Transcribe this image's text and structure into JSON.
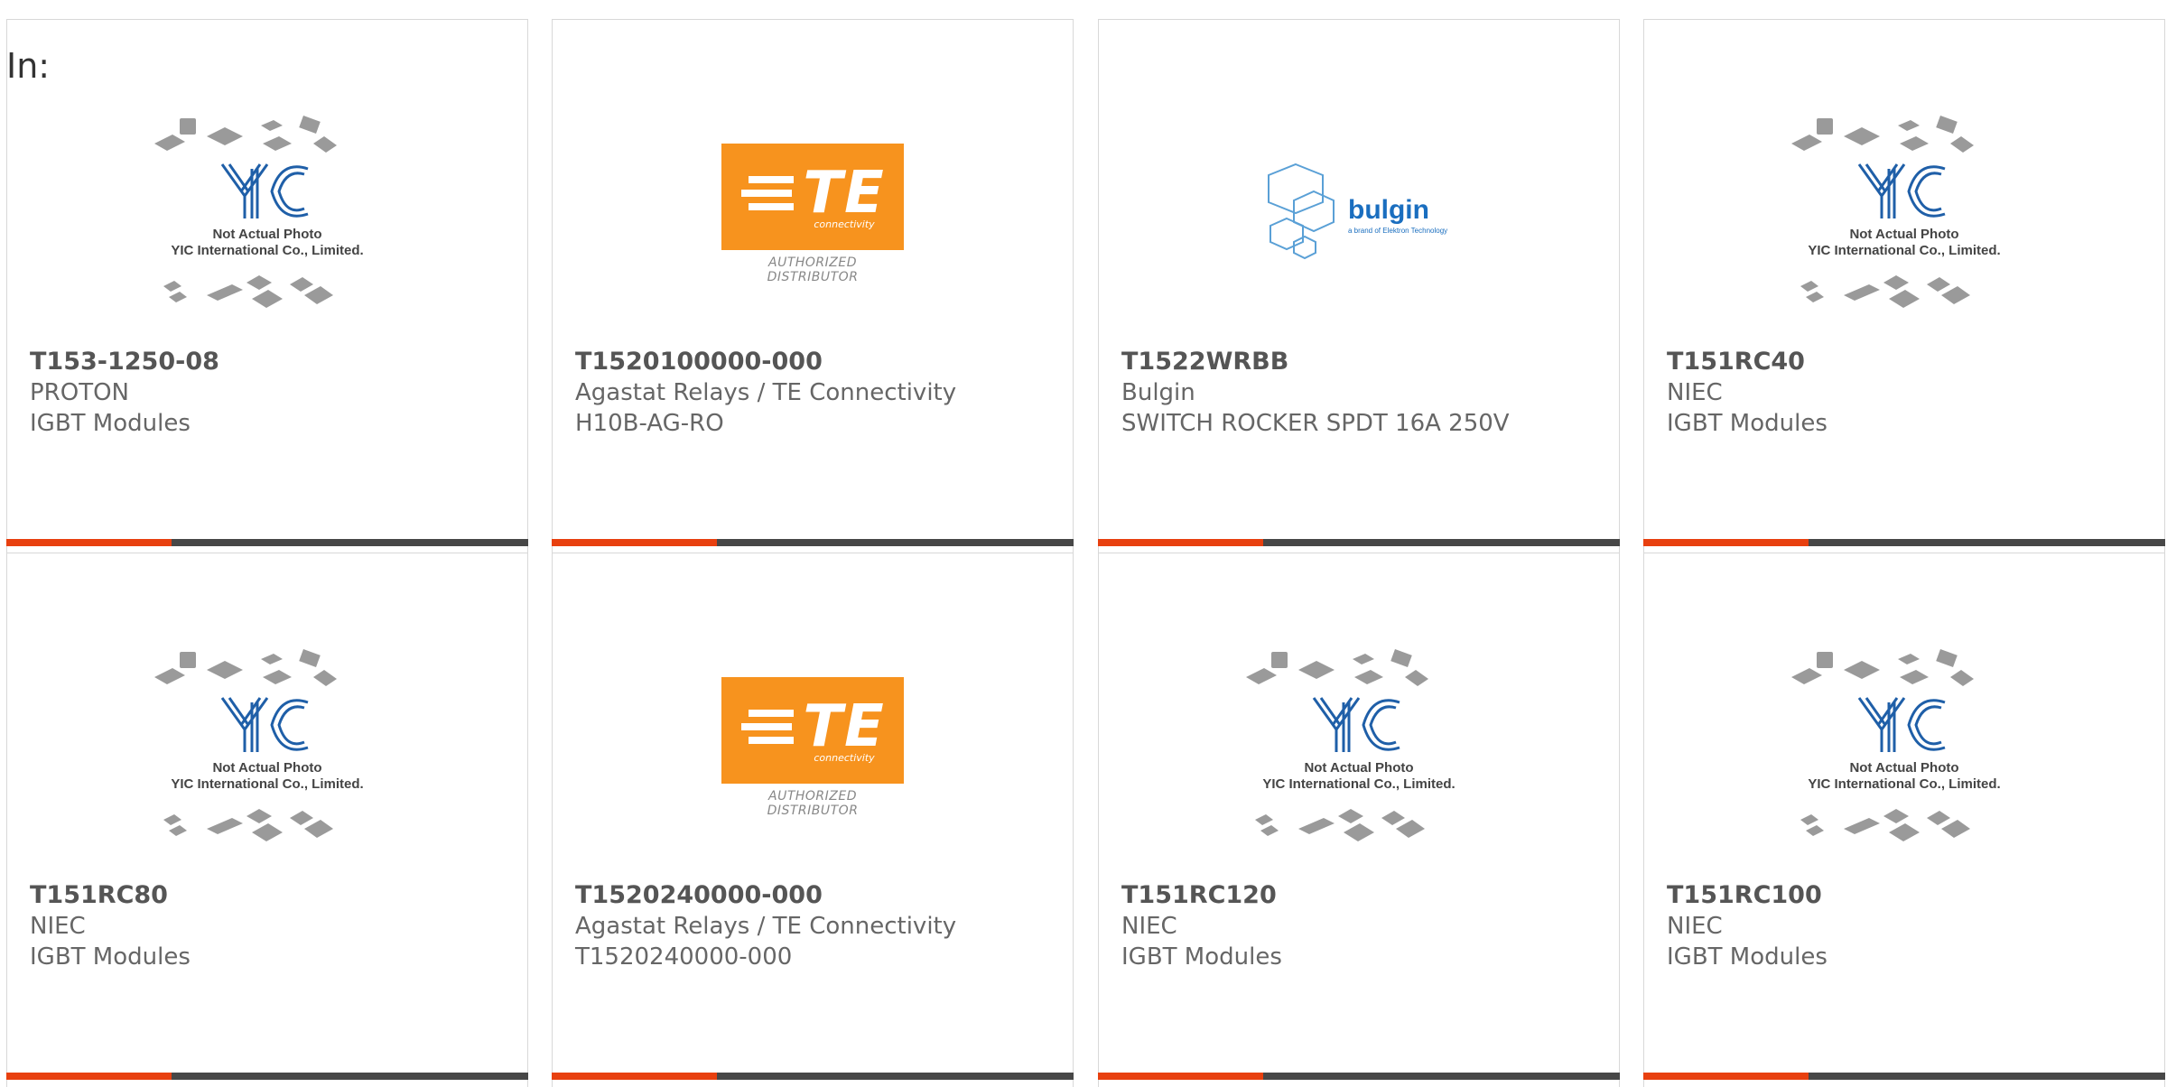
{
  "header": {
    "label": "In:"
  },
  "colors": {
    "accent": "#e8400f",
    "bar": "#474747",
    "te_orange": "#f7931e",
    "yic_blue": "#1f5fa8",
    "bulgin_blue": "#1a6ebf"
  },
  "placeholder": {
    "line1": "Not Actual Photo",
    "line2": "YIC International Co., Limited.",
    "mark": "YIC"
  },
  "te_logo": {
    "text": "TE",
    "sub": "connectivity",
    "auth": "AUTHORIZED DISTRIBUTOR"
  },
  "bulgin_logo": {
    "text": "bulgin",
    "sub": "a brand of Elektron Technology"
  },
  "products": [
    {
      "image": "placeholder",
      "part_number": "T153-1250-08",
      "manufacturer": "PROTON",
      "description": "IGBT Modules"
    },
    {
      "image": "te-logo",
      "part_number": "T1520100000-000",
      "manufacturer": "Agastat Relays / TE Connectivity",
      "description": "H10B-AG-RO"
    },
    {
      "image": "bulgin-logo",
      "part_number": "T1522WRBB",
      "manufacturer": "Bulgin",
      "description": "SWITCH ROCKER SPDT 16A 250V"
    },
    {
      "image": "placeholder",
      "part_number": "T151RC40",
      "manufacturer": "NIEC",
      "description": "IGBT Modules"
    },
    {
      "image": "placeholder",
      "part_number": "T151RC80",
      "manufacturer": "NIEC",
      "description": "IGBT Modules"
    },
    {
      "image": "te-logo",
      "part_number": "T1520240000-000",
      "manufacturer": "Agastat Relays / TE Connectivity",
      "description": "T1520240000-000"
    },
    {
      "image": "placeholder",
      "part_number": "T151RC120",
      "manufacturer": "NIEC",
      "description": "IGBT Modules"
    },
    {
      "image": "placeholder",
      "part_number": "T151RC100",
      "manufacturer": "NIEC",
      "description": "IGBT Modules"
    }
  ]
}
